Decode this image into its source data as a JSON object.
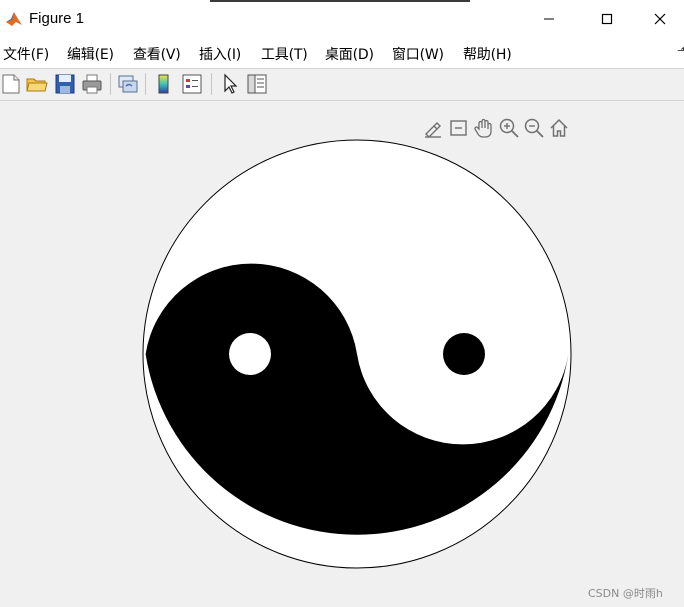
{
  "window": {
    "title": "Figure 1"
  },
  "menu": {
    "items": [
      {
        "label": "文件(F)"
      },
      {
        "label": "编辑(E)"
      },
      {
        "label": "查看(V)"
      },
      {
        "label": "插入(I)"
      },
      {
        "label": "工具(T)"
      },
      {
        "label": "桌面(D)"
      },
      {
        "label": "窗口(W)"
      },
      {
        "label": "帮助(H)"
      }
    ]
  },
  "toolbar": {
    "icons": [
      "new-figure-icon",
      "open-file-icon",
      "save-figure-icon",
      "print-figure-icon",
      "link-plot-icon",
      "insert-colorbar-icon",
      "insert-legend-icon",
      "edit-plot-icon",
      "property-inspector-icon"
    ]
  },
  "axes_toolbar": {
    "icons": [
      "brush-data-icon",
      "data-tips-icon",
      "pan-hand-icon",
      "zoom-in-icon",
      "zoom-out-icon",
      "restore-view-home-icon"
    ]
  },
  "plot": {
    "shape": "yin-yang",
    "fill_dark": "#000000",
    "fill_light": "#ffffff",
    "outline": "#000000"
  },
  "watermark": {
    "text": "CSDN @时雨h"
  },
  "colors": {
    "background": "#f0f0f0",
    "titlebar": "#ffffff"
  }
}
